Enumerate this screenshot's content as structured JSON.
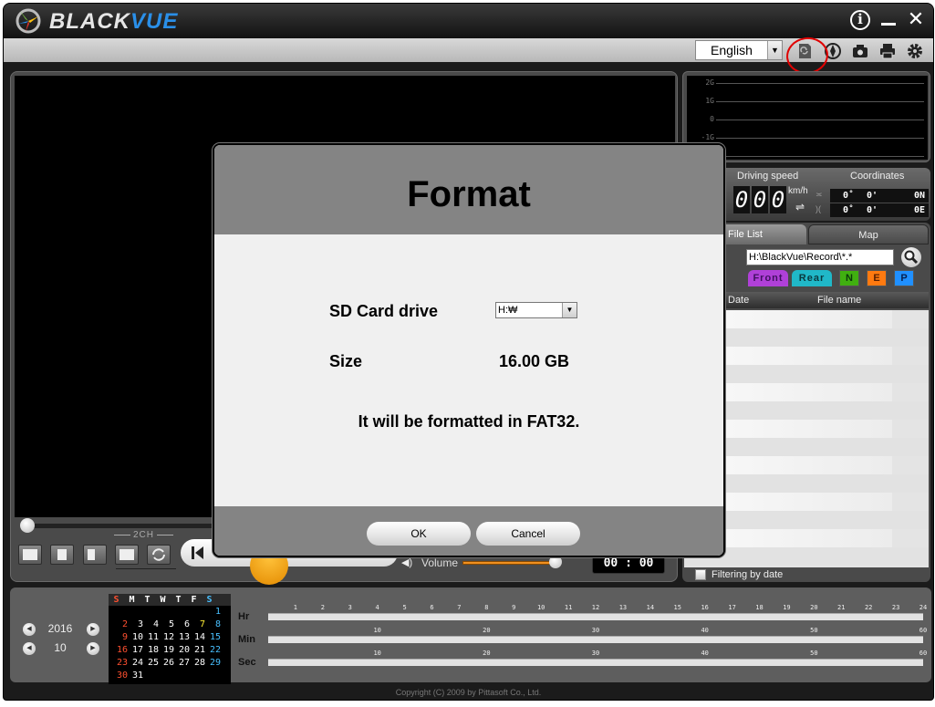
{
  "app": {
    "brand_prefix": "BLACK",
    "brand_suffix": "VUE",
    "info_label": "i",
    "close_label": "✕"
  },
  "toolbar": {
    "language": "English",
    "dropdown_arrow": "▼",
    "icons": [
      "sd-card-format-icon",
      "gps-compass-icon",
      "camera-icon",
      "printer-icon",
      "settings-gear-icon"
    ]
  },
  "gsensor": {
    "labels": [
      "2G",
      "1G",
      "0",
      "-1G"
    ]
  },
  "speed": {
    "title": "Driving speed",
    "digits": [
      "0",
      "0",
      "0"
    ],
    "unit": "km/h",
    "swap_icon": "⇌"
  },
  "coordinates": {
    "title": "Coordinates",
    "lat": {
      "deg": "0˚",
      "min": "0'",
      "dir": "0N"
    },
    "lon": {
      "deg": "0˚",
      "min": "0'",
      "dir": "0E"
    }
  },
  "file_list": {
    "tabs": [
      "File List",
      "Map"
    ],
    "path": "H:\\BlackVue\\Record\\*.*",
    "filters": {
      "front": "Front",
      "rear": "Rear",
      "n": "N",
      "e": "E",
      "p": "P"
    },
    "columns": {
      "date": "Date",
      "name": "File name"
    },
    "filter_by_date": "Filtering by date"
  },
  "controls": {
    "two_ch": "2CH",
    "volume_label": "Volume",
    "volume_level": 0.95,
    "seek_position": 0,
    "time": "00 : 00"
  },
  "calendar": {
    "year": "2016",
    "month": "10",
    "weekdays": [
      "S",
      "M",
      "T",
      "W",
      "T",
      "F",
      "S"
    ],
    "first_weekday": 6,
    "days_in_month": 31,
    "highlight_days": [
      7
    ]
  },
  "timeline": {
    "labels": {
      "hr": "Hr",
      "min": "Min",
      "sec": "Sec"
    },
    "hr_ticks": [
      "1",
      "2",
      "3",
      "4",
      "5",
      "6",
      "7",
      "8",
      "9",
      "10",
      "11",
      "12",
      "13",
      "14",
      "15",
      "16",
      "17",
      "18",
      "19",
      "20",
      "21",
      "22",
      "23",
      "24"
    ],
    "minsec_ticks": [
      "10",
      "20",
      "30",
      "40",
      "50",
      "60"
    ]
  },
  "copyright": "Copyright (C) 2009 by Pittasoft Co., Ltd.",
  "dialog": {
    "title": "Format",
    "drive_label": "SD Card drive",
    "drive_value": "H:₩",
    "size_label": "Size",
    "size_value": "16.00 GB",
    "message": "It will be formatted in FAT32.",
    "ok": "OK",
    "cancel": "Cancel"
  }
}
